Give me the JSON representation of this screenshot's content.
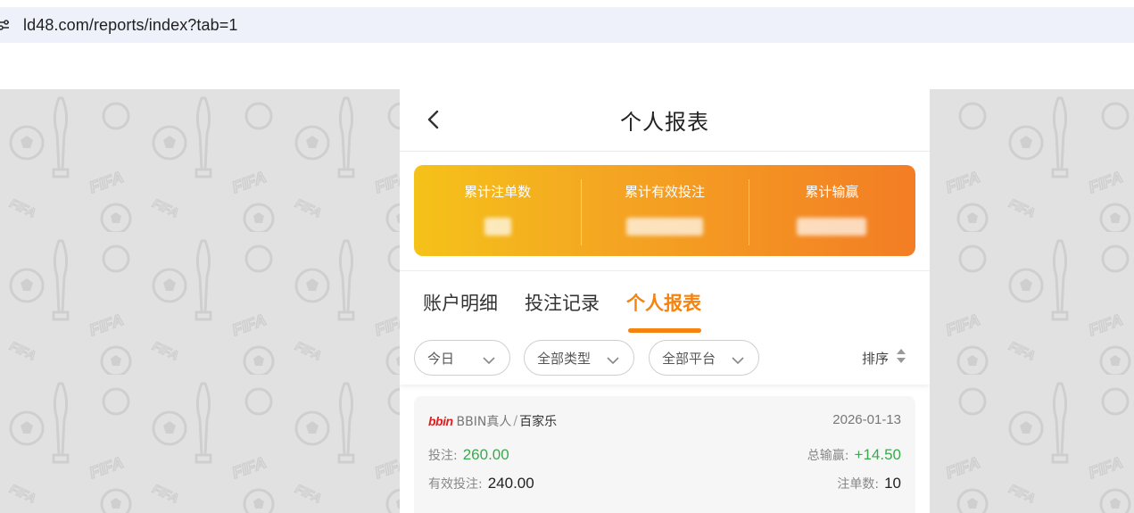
{
  "browser": {
    "url": "ld48.com/reports/index?tab=1",
    "site_icon": "site-settings-icon"
  },
  "header": {
    "back_icon": "chevron-left-icon",
    "title": "个人报表"
  },
  "summary": {
    "items": [
      {
        "label": "累计注单数"
      },
      {
        "label": "累计有效投注"
      },
      {
        "label": "累计输赢"
      }
    ]
  },
  "tabs": [
    {
      "label": "账户明细",
      "active": false
    },
    {
      "label": "投注记录",
      "active": false
    },
    {
      "label": "个人报表",
      "active": true
    }
  ],
  "filters": {
    "date": "今日",
    "type": "全部类型",
    "platform": "全部平台",
    "sort_label": "排序",
    "chevron_icon": "chevron-down-icon",
    "sort_icon": "sort-icon"
  },
  "records": [
    {
      "logo_text": "bbin",
      "provider": "BBIN真人",
      "separator": "/",
      "game": "百家乐",
      "date": "2026-01-13",
      "bet_label": "投注:",
      "bet_value": "260.00",
      "win_label": "总输赢:",
      "win_value": "+14.50",
      "valid_label": "有效投注:",
      "valid_value": "240.00",
      "count_label": "注单数:",
      "count_value": "10"
    }
  ],
  "colors": {
    "accent": "#f5830f",
    "positive": "#3aa94e",
    "summary_gradient_start": "#f5c219",
    "summary_gradient_end": "#f37d24"
  }
}
